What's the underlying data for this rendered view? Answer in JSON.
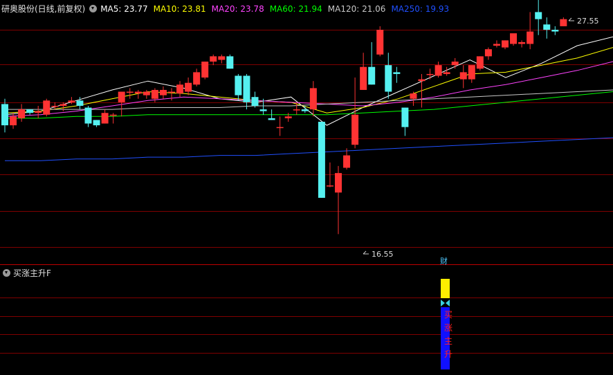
{
  "header": {
    "stock_title": "研奥股份(日线,前复权)",
    "ma": [
      {
        "label": "MA5: 23.77",
        "color": "#ffffff"
      },
      {
        "label": "MA10: 23.81",
        "color": "#ffff00"
      },
      {
        "label": "MA20: 23.78",
        "color": "#ff44ff"
      },
      {
        "label": "MA60: 21.94",
        "color": "#00ff00"
      },
      {
        "label": "MA120: 21.06",
        "color": "#c8c8c8"
      },
      {
        "label": "MA250: 19.93",
        "color": "#2050ff"
      }
    ]
  },
  "annotations": {
    "high": "27.55",
    "low": "16.55"
  },
  "indicator": {
    "title": "买涨主升F",
    "top_marker": "财",
    "signal_text": [
      "买",
      "涨",
      "主",
      "升"
    ]
  },
  "colors": {
    "up": "#ff3333",
    "down": "#55f0f0",
    "grid": "#800000",
    "divider": "#c00000"
  },
  "chart_data": {
    "type": "candlestick",
    "price_range": [
      15.0,
      29.0
    ],
    "candles": [
      [
        23.9,
        24.2,
        22.3,
        22.7
      ],
      [
        22.7,
        23.4,
        22.5,
        23.2
      ],
      [
        23.1,
        23.9,
        22.9,
        23.6
      ],
      [
        23.6,
        23.6,
        23.3,
        23.4
      ],
      [
        23.4,
        23.8,
        23.1,
        23.5
      ],
      [
        23.3,
        24.2,
        23.2,
        24.1
      ],
      [
        23.8,
        24.0,
        23.6,
        23.8
      ],
      [
        23.8,
        24.0,
        23.5,
        23.9
      ],
      [
        24.0,
        24.3,
        23.9,
        24.1
      ],
      [
        24.1,
        24.3,
        23.6,
        23.8
      ],
      [
        23.7,
        23.8,
        22.6,
        22.8
      ],
      [
        23.0,
        23.0,
        22.6,
        22.7
      ],
      [
        22.8,
        23.6,
        22.8,
        23.4
      ],
      [
        23.3,
        23.4,
        22.8,
        23.3
      ],
      [
        24.0,
        24.1,
        23.2,
        24.6
      ],
      [
        24.6,
        24.8,
        24.2,
        24.6
      ],
      [
        24.5,
        24.7,
        24.2,
        24.6
      ],
      [
        24.4,
        24.7,
        24.2,
        24.6
      ],
      [
        24.2,
        24.8,
        24.0,
        24.7
      ],
      [
        24.4,
        24.9,
        24.2,
        24.7
      ],
      [
        24.6,
        24.8,
        24.1,
        24.6
      ],
      [
        24.5,
        25.2,
        24.3,
        25.0
      ],
      [
        24.6,
        25.4,
        24.4,
        25.1
      ],
      [
        25.0,
        25.9,
        24.9,
        25.7
      ],
      [
        25.4,
        26.3,
        25.3,
        26.3
      ],
      [
        26.3,
        26.7,
        26.1,
        26.6
      ],
      [
        26.4,
        26.7,
        26.2,
        26.6
      ],
      [
        26.6,
        26.7,
        25.9,
        25.9
      ],
      [
        25.5,
        25.6,
        24.1,
        24.4
      ],
      [
        25.5,
        25.6,
        23.6,
        24.0
      ],
      [
        24.3,
        24.6,
        23.7,
        23.8
      ],
      [
        23.6,
        24.2,
        23.3,
        23.5
      ],
      [
        23.1,
        23.6,
        23.0,
        23.0
      ],
      [
        22.6,
        23.2,
        22.1,
        22.6
      ],
      [
        23.1,
        23.4,
        22.9,
        23.2
      ],
      [
        23.6,
        24.0,
        23.3,
        23.6
      ],
      [
        23.6,
        23.8,
        23.4,
        23.5
      ],
      [
        23.6,
        25.2,
        23.2,
        24.8
      ],
      [
        22.9,
        22.9,
        18.6,
        18.6
      ],
      [
        19.3,
        20.6,
        19.2,
        19.3
      ],
      [
        18.9,
        20.4,
        16.55,
        20.0
      ],
      [
        20.3,
        21.4,
        20.2,
        21.0
      ],
      [
        21.6,
        25.4,
        21.4,
        23.3
      ],
      [
        24.7,
        26.8,
        24.7,
        26.0
      ],
      [
        26.0,
        27.4,
        25.0,
        25.0
      ],
      [
        26.7,
        28.3,
        26.6,
        28.1
      ],
      [
        26.1,
        26.8,
        24.2,
        24.6
      ],
      [
        25.7,
        26.0,
        25.1,
        25.6
      ],
      [
        23.7,
        23.7,
        22.1,
        22.6
      ],
      [
        24.2,
        24.6,
        23.8,
        24.5
      ],
      [
        25.2,
        25.6,
        23.7,
        25.3
      ],
      [
        25.6,
        25.9,
        25.3,
        25.6
      ],
      [
        25.5,
        26.3,
        25.4,
        26.1
      ],
      [
        25.6,
        26.0,
        25.5,
        25.7
      ],
      [
        26.1,
        26.5,
        25.9,
        26.3
      ],
      [
        25.3,
        26.1,
        24.8,
        25.7
      ],
      [
        25.3,
        26.0,
        25.1,
        26.1
      ],
      [
        25.9,
        26.6,
        25.8,
        26.6
      ],
      [
        26.6,
        27.1,
        26.4,
        27.0
      ],
      [
        27.2,
        27.5,
        27.1,
        27.3
      ],
      [
        27.1,
        27.5,
        27.0,
        27.5
      ],
      [
        27.3,
        27.8,
        27.2,
        27.9
      ],
      [
        27.3,
        27.5,
        27.1,
        27.4
      ],
      [
        27.3,
        29.1,
        27.0,
        28.0
      ],
      [
        29.1,
        29.8,
        27.8,
        28.7
      ],
      [
        28.4,
        28.8,
        27.6,
        28.1
      ],
      [
        28.1,
        28.3,
        27.8,
        28.0
      ],
      [
        28.3,
        28.8,
        28.3,
        28.7
      ]
    ],
    "ma_series": [
      {
        "name": "MA5",
        "values": [
          23.3,
          23.5,
          24.1,
          24.7,
          25.2,
          24.8,
          24.2,
          24.0,
          24.3,
          22.7,
          23.7,
          24.6,
          25.5,
          26.4,
          25.4,
          26.2,
          27.2,
          27.7
        ]
      },
      {
        "name": "MA10",
        "values": [
          23.4,
          23.5,
          23.8,
          24.2,
          24.6,
          24.5,
          24.3,
          24.1,
          24.0,
          23.4,
          23.7,
          24.2,
          24.9,
          25.6,
          25.7,
          26.1,
          26.5,
          27.1
        ]
      },
      {
        "name": "MA20",
        "values": [
          23.2,
          23.3,
          23.5,
          23.8,
          24.1,
          24.3,
          24.2,
          24.1,
          24.0,
          23.9,
          23.8,
          24.0,
          24.3,
          24.7,
          25.0,
          25.4,
          25.8,
          26.3
        ]
      },
      {
        "name": "MA60",
        "values": [
          23.1,
          23.1,
          23.2,
          23.2,
          23.3,
          23.3,
          23.3,
          23.3,
          23.3,
          23.3,
          23.4,
          23.5,
          23.6,
          23.8,
          24.0,
          24.2,
          24.4,
          24.6
        ]
      },
      {
        "name": "MA120",
        "values": [
          23.6,
          23.6,
          23.6,
          23.6,
          23.7,
          23.7,
          23.7,
          23.8,
          23.8,
          23.9,
          24.0,
          24.1,
          24.2,
          24.3,
          24.4,
          24.5,
          24.6,
          24.7
        ]
      },
      {
        "name": "MA250",
        "values": [
          20.7,
          20.7,
          20.8,
          20.8,
          20.9,
          20.9,
          21.0,
          21.0,
          21.1,
          21.2,
          21.3,
          21.4,
          21.5,
          21.6,
          21.7,
          21.8,
          21.9,
          22.0
        ]
      }
    ]
  }
}
